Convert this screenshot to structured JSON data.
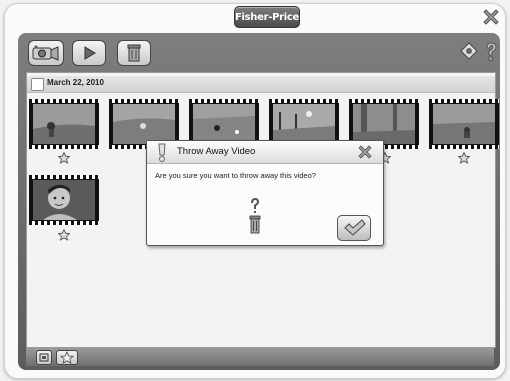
{
  "app": {
    "logo_text": "Fisher-Price"
  },
  "toolbar": {
    "buttons": [
      "camera-icon",
      "play-icon",
      "trash-icon"
    ],
    "right_icons": [
      "back-icon",
      "help-icon"
    ]
  },
  "gallery": {
    "date_label": "March 22, 2010",
    "thumbnails": [
      {
        "scene": "outdoor-grass"
      },
      {
        "scene": "outdoor-grass"
      },
      {
        "scene": "outdoor-grass"
      },
      {
        "scene": "outdoor-grass"
      },
      {
        "scene": "outdoor-trees"
      },
      {
        "scene": "outdoor-grass"
      },
      {
        "scene": "child-portrait"
      }
    ]
  },
  "dialog": {
    "title": "Throw Away Video",
    "message": "Are you sure you want to throw away this video?",
    "icons": [
      "warning-icon",
      "question-icon",
      "trash-icon",
      "checkmark-icon",
      "close-icon"
    ]
  },
  "colors": {
    "frame": "#6b6b6b",
    "background": "#f3f3f3",
    "dialog_bg": "#fbfbfb"
  }
}
